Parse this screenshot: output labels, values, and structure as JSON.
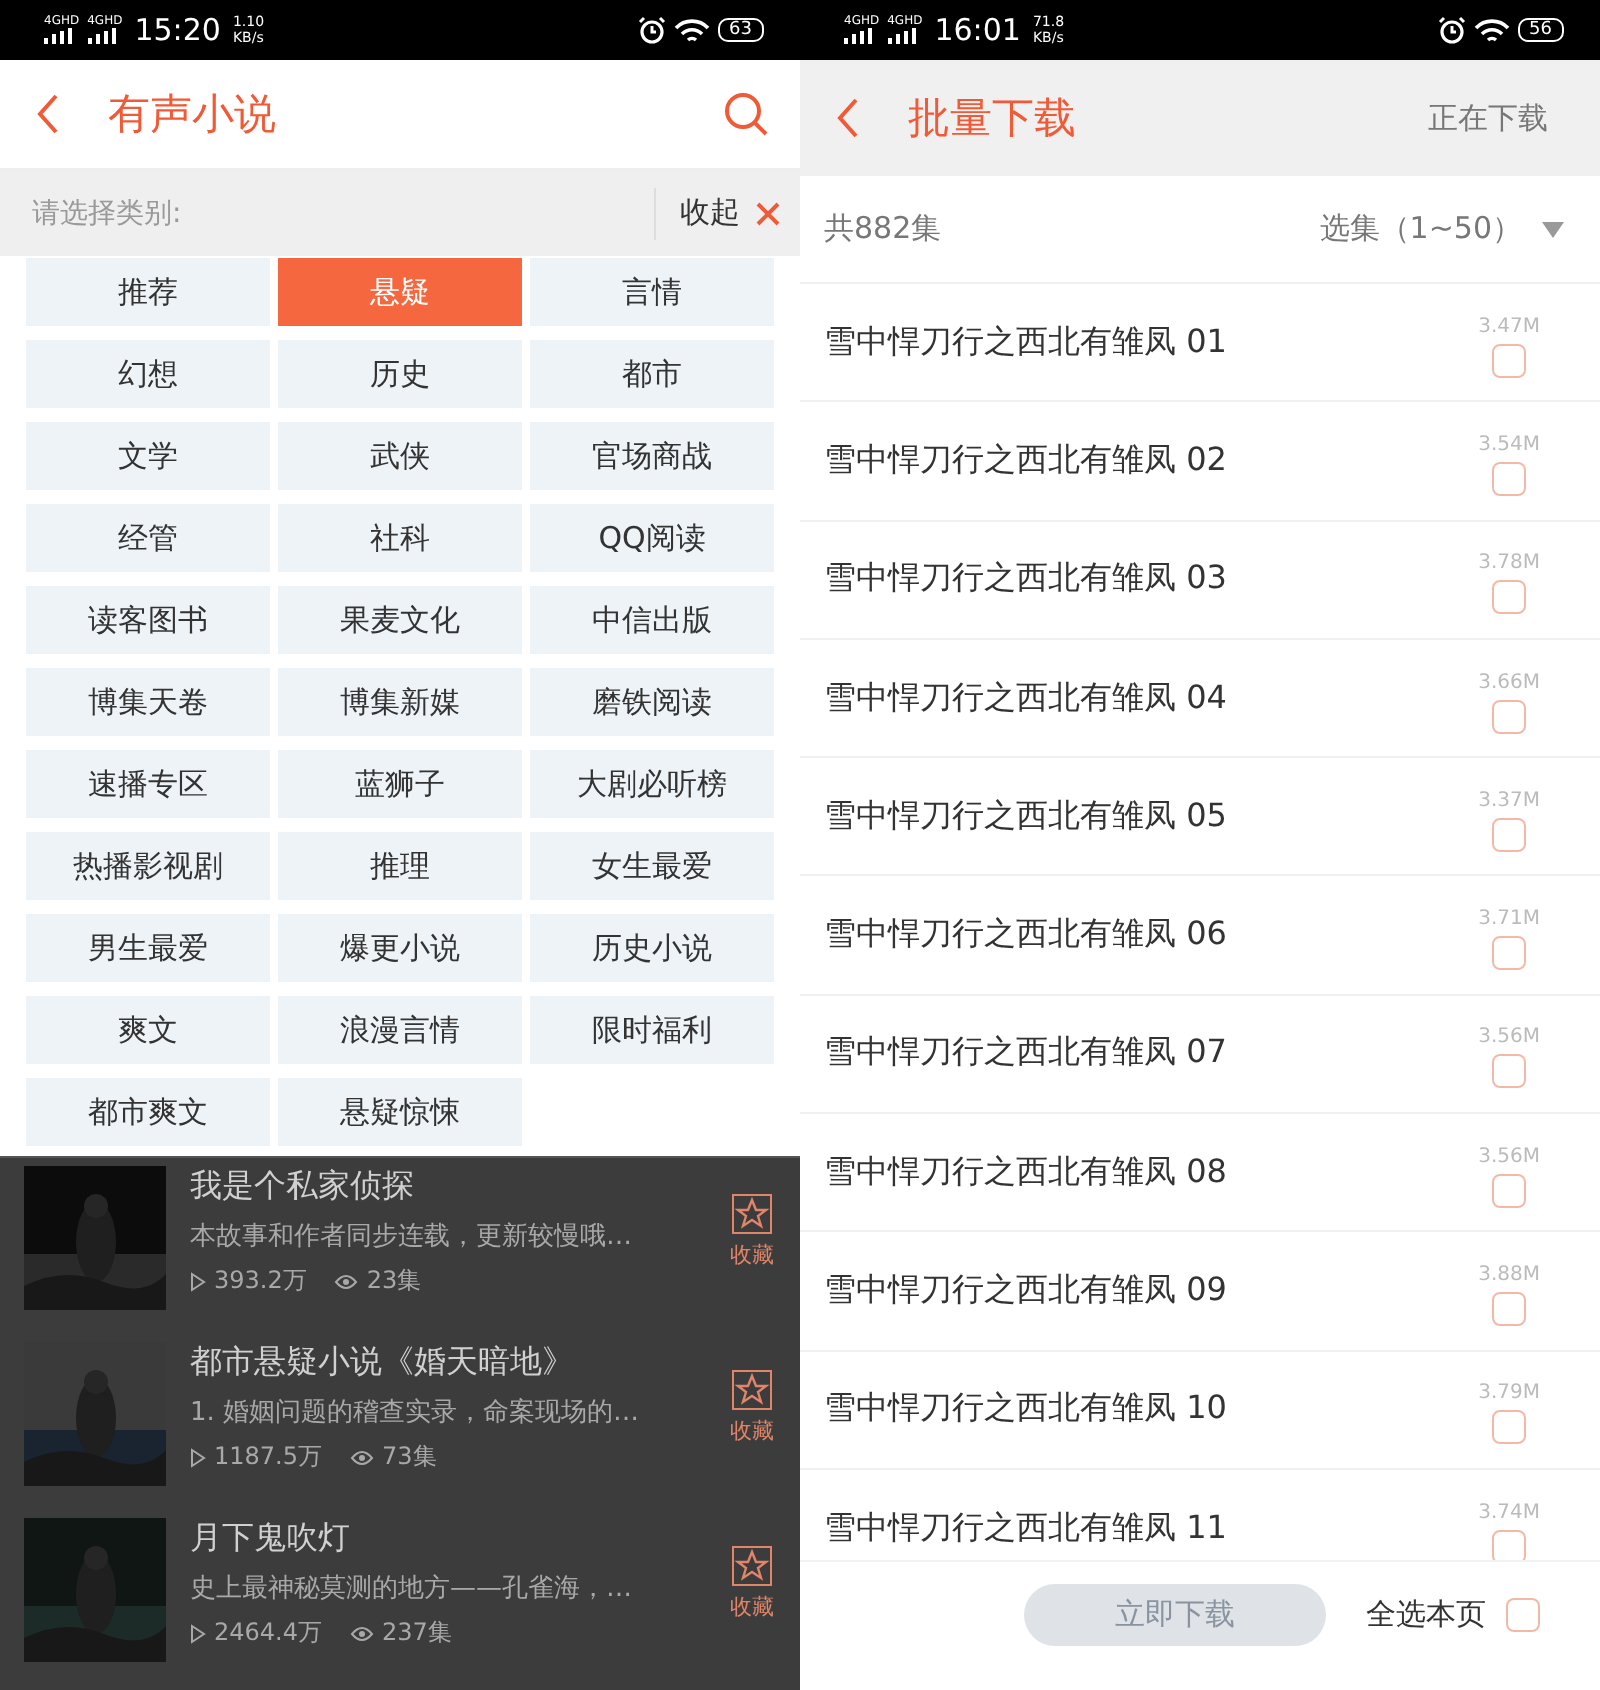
{
  "left": {
    "status_bar": {
      "signals": [
        "4GHD",
        "4GHD"
      ],
      "time": "15:20",
      "speed": [
        "1.10",
        "KB/s"
      ],
      "battery": "63"
    },
    "header": {
      "title": "有声小说"
    },
    "category_bar": {
      "prompt": "请选择类别:",
      "collapse": "收起"
    },
    "categories": [
      {
        "label": "推荐",
        "selected": false
      },
      {
        "label": "悬疑",
        "selected": true
      },
      {
        "label": "言情",
        "selected": false
      },
      {
        "label": "幻想",
        "selected": false
      },
      {
        "label": "历史",
        "selected": false
      },
      {
        "label": "都市",
        "selected": false
      },
      {
        "label": "文学",
        "selected": false
      },
      {
        "label": "武侠",
        "selected": false
      },
      {
        "label": "官场商战",
        "selected": false
      },
      {
        "label": "经管",
        "selected": false
      },
      {
        "label": "社科",
        "selected": false
      },
      {
        "label": "QQ阅读",
        "selected": false
      },
      {
        "label": "读客图书",
        "selected": false
      },
      {
        "label": "果麦文化",
        "selected": false
      },
      {
        "label": "中信出版",
        "selected": false
      },
      {
        "label": "博集天卷",
        "selected": false
      },
      {
        "label": "博集新媒",
        "selected": false
      },
      {
        "label": "磨铁阅读",
        "selected": false
      },
      {
        "label": "速播专区",
        "selected": false
      },
      {
        "label": "蓝狮子",
        "selected": false
      },
      {
        "label": "大剧必听榜",
        "selected": false
      },
      {
        "label": "热播影视剧",
        "selected": false
      },
      {
        "label": "推理",
        "selected": false
      },
      {
        "label": "女生最爱",
        "selected": false
      },
      {
        "label": "男生最爱",
        "selected": false
      },
      {
        "label": "爆更小说",
        "selected": false
      },
      {
        "label": "历史小说",
        "selected": false
      },
      {
        "label": "爽文",
        "selected": false
      },
      {
        "label": "浪漫言情",
        "selected": false
      },
      {
        "label": "限时福利",
        "selected": false
      },
      {
        "label": "都市爽文",
        "selected": false
      },
      {
        "label": "悬疑惊悚",
        "selected": false
      }
    ],
    "books": [
      {
        "title": "我是个私家侦探",
        "description": "本故事和作者同步连载，更新较慢哦…",
        "plays": "393.2万",
        "episodes": "23集",
        "favorite": "收藏"
      },
      {
        "title": "都市悬疑小说《婚天暗地》",
        "description": "1. 婚姻问题的稽查实录，命案现场的…",
        "plays": "1187.5万",
        "episodes": "73集",
        "favorite": "收藏"
      },
      {
        "title": "月下鬼吹灯",
        "description": "史上最神秘莫测的地方——孔雀海，…",
        "plays": "2464.4万",
        "episodes": "237集",
        "favorite": "收藏"
      }
    ]
  },
  "right": {
    "status_bar": {
      "signals": [
        "4GHD",
        "4GHD"
      ],
      "time": "16:01",
      "speed": [
        "71.8",
        "KB/s"
      ],
      "battery": "56"
    },
    "header": {
      "title": "批量下载",
      "action": "正在下载"
    },
    "summary": {
      "count": "共882集",
      "range": "选集（1~50）"
    },
    "episodes": [
      {
        "title": "雪中悍刀行之西北有雏凤 01",
        "size": "3.47M",
        "checked": false
      },
      {
        "title": "雪中悍刀行之西北有雏凤 02",
        "size": "3.54M",
        "checked": false
      },
      {
        "title": "雪中悍刀行之西北有雏凤 03",
        "size": "3.78M",
        "checked": false
      },
      {
        "title": "雪中悍刀行之西北有雏凤 04",
        "size": "3.66M",
        "checked": false
      },
      {
        "title": "雪中悍刀行之西北有雏凤 05",
        "size": "3.37M",
        "checked": false
      },
      {
        "title": "雪中悍刀行之西北有雏凤 06",
        "size": "3.71M",
        "checked": false
      },
      {
        "title": "雪中悍刀行之西北有雏凤 07",
        "size": "3.56M",
        "checked": false
      },
      {
        "title": "雪中悍刀行之西北有雏凤 08",
        "size": "3.56M",
        "checked": false
      },
      {
        "title": "雪中悍刀行之西北有雏凤 09",
        "size": "3.88M",
        "checked": false
      },
      {
        "title": "雪中悍刀行之西北有雏凤 10",
        "size": "3.79M",
        "checked": false
      },
      {
        "title": "雪中悍刀行之西北有雏凤 11",
        "size": "3.74M",
        "checked": false
      }
    ],
    "footer": {
      "download": {
        "label": "立即下载",
        "disabled": true
      },
      "select_all": {
        "label": "全选本页",
        "checked": false
      }
    }
  }
}
